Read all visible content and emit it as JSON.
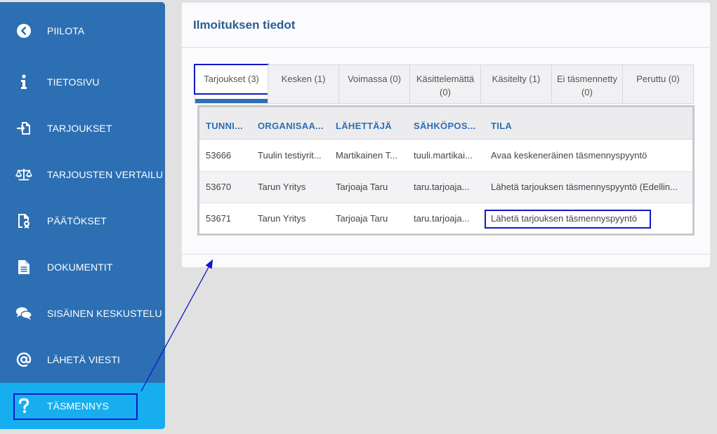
{
  "sidebar": {
    "items": [
      {
        "label": "PIILOTA",
        "icon": "chevron-left-circle-icon"
      },
      {
        "label": "TIETOSIVU",
        "icon": "info-icon"
      },
      {
        "label": "TARJOUKSET",
        "icon": "file-import-icon"
      },
      {
        "label": "TARJOUSTEN VERTAILU",
        "icon": "scale-icon"
      },
      {
        "label": "PÄÄTÖKSET",
        "icon": "certificate-icon"
      },
      {
        "label": "DOKUMENTIT",
        "icon": "document-icon"
      },
      {
        "label": "SISÄINEN KESKUSTELU",
        "icon": "chat-bubbles-icon"
      },
      {
        "label": "LÄHETÄ VIESTI",
        "icon": "at-sign-icon"
      },
      {
        "label": "TÄSMENNYS",
        "icon": "question-mark-icon",
        "active": true
      }
    ]
  },
  "card": {
    "title": "Ilmoituksen tiedot"
  },
  "tabs": [
    {
      "label": "Tarjoukset (3)",
      "active": true
    },
    {
      "label": "Kesken (1)"
    },
    {
      "label": "Voimassa (0)"
    },
    {
      "label": "Käsittelemättä (0)"
    },
    {
      "label": "Käsitelty (1)"
    },
    {
      "label": "Ei täsmennetty (0)"
    },
    {
      "label": "Peruttu (0)"
    }
  ],
  "table": {
    "headers": [
      "TUNNI...",
      "ORGANISAA...",
      "LÄHETTÄJÄ",
      "SÄHKÖPOS...",
      "TILA"
    ],
    "rows": [
      [
        "53666",
        "Tuulin testiyrit...",
        "Martikainen T...",
        "tuuli.martikai...",
        "Avaa keskeneräinen täsmennyspyyntö"
      ],
      [
        "53670",
        "Tarun Yritys",
        "Tarjoaja Taru",
        "taru.tarjoaja...",
        "Lähetä tarjouksen täsmennyspyyntö (Edellin..."
      ],
      [
        "53671",
        "Tarun Yritys",
        "Tarjoaja Taru",
        "taru.tarjoaja...",
        "Lähetä tarjouksen täsmennyspyyntö"
      ]
    ]
  },
  "colors": {
    "sidebar": "#2c6fb3",
    "sidebar_active": "#17aef0",
    "annotation": "#1019c8",
    "header_text": "#2c6fb3"
  }
}
